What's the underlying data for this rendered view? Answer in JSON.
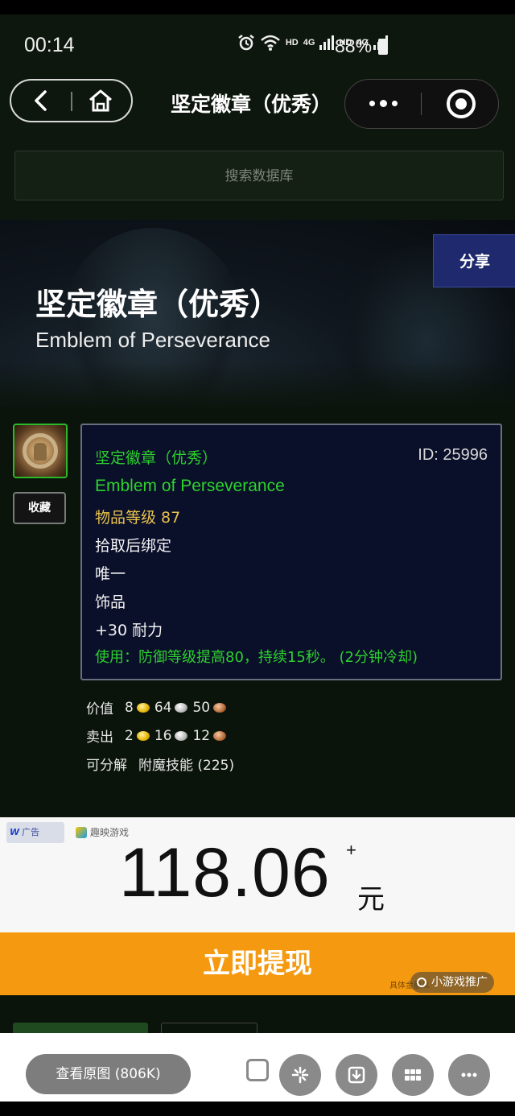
{
  "status_bar": {
    "time": "00:14",
    "hd1": "HD",
    "net1": "4G",
    "hd2": "HD",
    "net2": "4G",
    "battery": "88%"
  },
  "nav": {
    "title": "坚定徽章（优秀）"
  },
  "search": {
    "placeholder": "搜索数据库"
  },
  "hero": {
    "title": "坚定徽章（优秀）",
    "subtitle": "Emblem of Perseverance",
    "share_label": "分享"
  },
  "item": {
    "favorite_label": "收藏",
    "name_cn": "坚定徽章（优秀）",
    "name_en": "Emblem of Perseverance",
    "id_text": "ID: 25996",
    "item_level": "物品等级 87",
    "bind": "拾取后绑定",
    "unique": "唯一",
    "slot": "饰品",
    "stat": "+30 耐力",
    "use_effect": "使用：防御等级提高80，持续15秒。 (2分钟冷却)"
  },
  "prices": {
    "value": {
      "label": "价值",
      "gold": "8",
      "silver": "64",
      "copper": "50"
    },
    "sell": {
      "label": "卖出",
      "gold": "2",
      "silver": "16",
      "copper": "12"
    },
    "disenchant": {
      "label": "可分解",
      "text": "附魔技能 (225)"
    }
  },
  "ad": {
    "badge1": "广告",
    "badge2": "趣映游戏",
    "amount": "118.06",
    "plus": "+",
    "unit": "元",
    "cta": "立即提现",
    "tag": "小游戏推广",
    "disclaimer": "具体金额以"
  },
  "viewer": {
    "view_original": "查看原图 (806K)"
  },
  "colors": {
    "quality_green": "#2ed12e",
    "item_level_gold": "#e8c24c",
    "tooltip_bg": "#0a0f2a",
    "share_blue": "#1f2a6e",
    "cta_orange": "#f59a10"
  }
}
